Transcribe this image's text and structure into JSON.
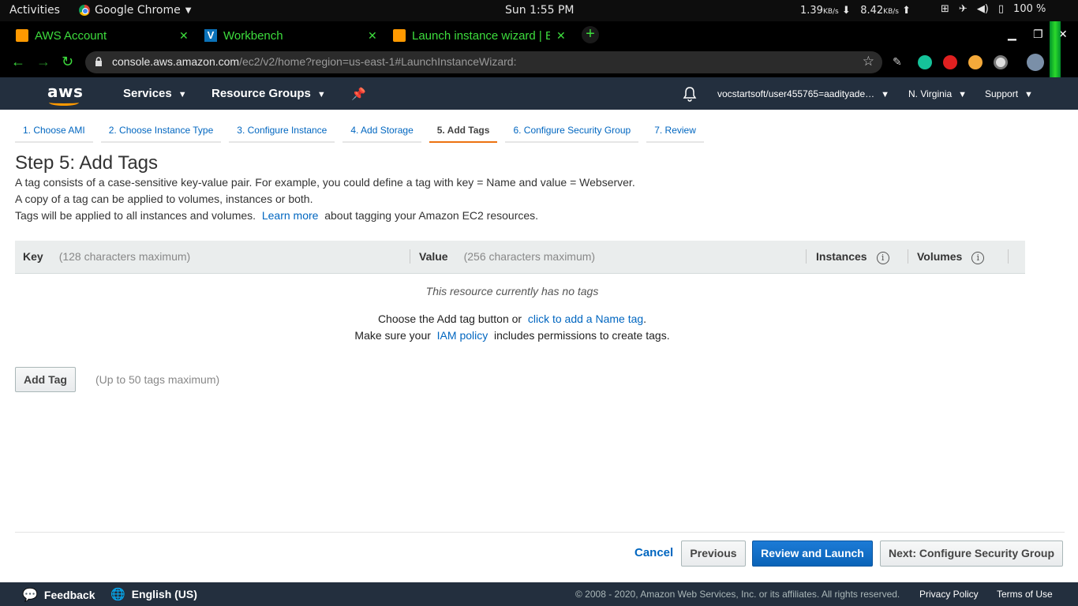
{
  "os": {
    "activities": "Activities",
    "app_name": "Google Chrome",
    "clock": "Sun  1:55 PM",
    "net_down": "1.39",
    "net_up": "8.42",
    "net_unit": "KB/s",
    "battery": "100 %"
  },
  "browser": {
    "tabs": [
      {
        "label": "AWS Account",
        "icon": "aws-box-icon"
      },
      {
        "label": "Workbench",
        "icon": "vocareum-v-icon"
      },
      {
        "label": "Launch instance wizard | E",
        "icon": "aws-box-icon"
      }
    ],
    "url_host": "console.aws.amazon.com",
    "url_path": "/ec2/v2/home?region=us-east-1#LaunchInstanceWizard:",
    "accent": "#3ddc3d"
  },
  "aws_nav": {
    "logo": "aws",
    "services": "Services",
    "resource_groups": "Resource Groups",
    "account": "vocstartsoft/user455765=aadityade…",
    "region": "N. Virginia",
    "support": "Support"
  },
  "steps": [
    "1. Choose AMI",
    "2. Choose Instance Type",
    "3. Configure Instance",
    "4. Add Storage",
    "5. Add Tags",
    "6. Configure Security Group",
    "7. Review"
  ],
  "active_step": 4,
  "page": {
    "title": "Step 5: Add Tags",
    "line1": "A tag consists of a case-sensitive key-value pair. For example, you could define a tag with key = Name and value = Webserver.",
    "line2": "A copy of a tag can be applied to volumes, instances or both.",
    "line3_pre": "Tags will be applied to all instances and volumes.",
    "learn_more": "Learn more",
    "line3_post": "about tagging your Amazon EC2 resources."
  },
  "table": {
    "key_header": "Key",
    "key_hint": "(128 characters maximum)",
    "value_header": "Value",
    "value_hint": "(256 characters maximum)",
    "instances_header": "Instances",
    "volumes_header": "Volumes",
    "empty_text": "This resource currently has no tags",
    "choose_pre": "Choose the Add tag button or",
    "choose_link": "click to add a Name tag",
    "choose_post": ".",
    "iam_pre": "Make sure your",
    "iam_link": "IAM policy",
    "iam_post": "includes permissions to create tags."
  },
  "add_tag": {
    "button": "Add Tag",
    "limit": "(Up to 50 tags maximum)"
  },
  "actions": {
    "cancel": "Cancel",
    "previous": "Previous",
    "review_launch": "Review and Launch",
    "next": "Next: Configure Security Group"
  },
  "footer": {
    "feedback": "Feedback",
    "language": "English (US)",
    "copyright": "© 2008 - 2020, Amazon Web Services, Inc. or its affiliates. All rights reserved.",
    "privacy": "Privacy Policy",
    "terms": "Terms of Use"
  }
}
